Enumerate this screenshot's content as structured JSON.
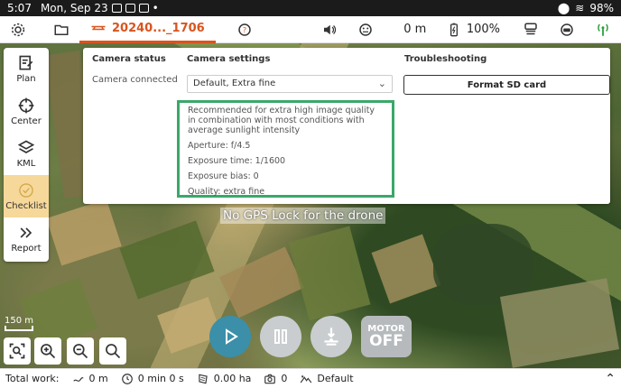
{
  "statusbar": {
    "time": "5:07",
    "date": "Mon, Sep 23",
    "battery": "98%"
  },
  "toolbar": {
    "mission_name": "20240..._1706",
    "altitude": "0 m",
    "battery_percent": "100%"
  },
  "left_menu": {
    "items": [
      {
        "label": "Plan",
        "icon": "plan-icon"
      },
      {
        "label": "Center",
        "icon": "crosshair-icon"
      },
      {
        "label": "KML",
        "icon": "kml-layers-icon"
      },
      {
        "label": "Checklist",
        "icon": "check-circle-icon"
      },
      {
        "label": "Report",
        "icon": "chevrons-right-icon"
      }
    ]
  },
  "panel": {
    "camera_status_header": "Camera status",
    "camera_status_value": "Camera connected",
    "camera_settings_header": "Camera settings",
    "preset_selected": "Default, Extra fine",
    "description": "Recommended for extra high image quality in combination with most conditions with average sunlight intensity",
    "aperture": "Aperture: f/4.5",
    "exposure_time": "Exposure time: 1/1600",
    "exposure_bias": "Exposure bias: 0",
    "quality": "Quality: extra fine",
    "troubleshooting_header": "Troubleshooting",
    "format_button": "Format SD card"
  },
  "map": {
    "gps_message": "No GPS Lock for the drone",
    "scale_label": "150 m"
  },
  "controls": {
    "motor_line1": "MOTOR",
    "motor_line2": "OFF"
  },
  "bottombar": {
    "total_work_label": "Total work:",
    "distance": "0 m",
    "time": "0 min 0 s",
    "area": "0.00 ha",
    "photos": "0",
    "profile": "Default"
  },
  "colors": {
    "accent": "#d9541e",
    "highlight": "#3aa86a",
    "play": "#3b8fa8"
  }
}
